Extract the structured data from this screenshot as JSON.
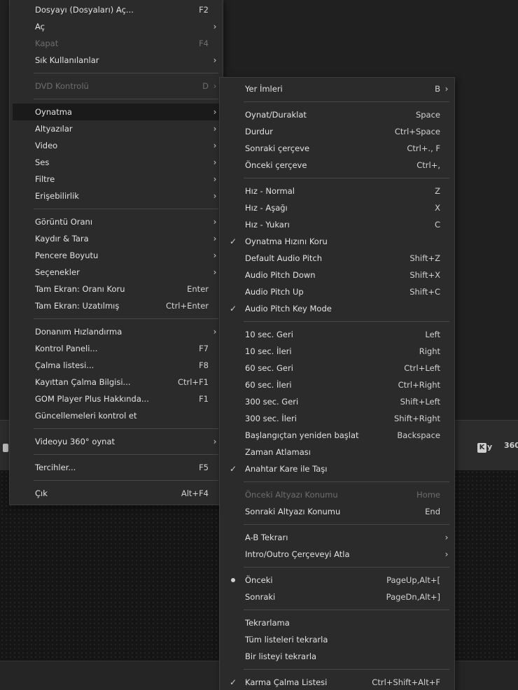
{
  "player_bar": {
    "ky_k": "K",
    "ky_y": "y",
    "vr_label": "360"
  },
  "main_menu": {
    "items": [
      {
        "label": "Dosyayı (Dosyaları) Aç...",
        "shortcut": "F2"
      },
      {
        "label": "Aç",
        "shortcut": ""
      },
      {
        "label": "Kapat",
        "shortcut": "F4"
      },
      {
        "label": "Sık Kullanılanlar",
        "shortcut": ""
      },
      {
        "label": "DVD Kontrolü",
        "shortcut": "D"
      },
      {
        "label": "Oynatma",
        "shortcut": ""
      },
      {
        "label": "Altyazılar",
        "shortcut": ""
      },
      {
        "label": "Video",
        "shortcut": ""
      },
      {
        "label": "Ses",
        "shortcut": ""
      },
      {
        "label": "Filtre",
        "shortcut": ""
      },
      {
        "label": "Erişebilirlik",
        "shortcut": ""
      },
      {
        "label": "Görüntü Oranı",
        "shortcut": ""
      },
      {
        "label": "Kaydır & Tara",
        "shortcut": ""
      },
      {
        "label": "Pencere Boyutu",
        "shortcut": ""
      },
      {
        "label": "Seçenekler",
        "shortcut": ""
      },
      {
        "label": "Tam Ekran: Oranı Koru",
        "shortcut": "Enter"
      },
      {
        "label": "Tam Ekran: Uzatılmış",
        "shortcut": "Ctrl+Enter"
      },
      {
        "label": "Donanım Hızlandırma",
        "shortcut": ""
      },
      {
        "label": "Kontrol Paneli...",
        "shortcut": "F7"
      },
      {
        "label": "Çalma listesi...",
        "shortcut": "F8"
      },
      {
        "label": "Kayıttan Çalma Bilgisi...",
        "shortcut": "Ctrl+F1"
      },
      {
        "label": "GOM Player Plus Hakkında...",
        "shortcut": "F1"
      },
      {
        "label": "Güncellemeleri kontrol et",
        "shortcut": ""
      },
      {
        "label": "Videoyu 360° oynat",
        "shortcut": ""
      },
      {
        "label": "Tercihler...",
        "shortcut": "F5"
      },
      {
        "label": "Çık",
        "shortcut": "Alt+F4"
      }
    ]
  },
  "playback_menu": {
    "items": [
      {
        "label": "Yer İmleri",
        "shortcut": "B"
      },
      {
        "label": "Oynat/Duraklat",
        "shortcut": "Space"
      },
      {
        "label": "Durdur",
        "shortcut": "Ctrl+Space"
      },
      {
        "label": "Sonraki çerçeve",
        "shortcut": "Ctrl+., F"
      },
      {
        "label": "Önceki çerçeve",
        "shortcut": "Ctrl+,"
      },
      {
        "label": "Hız - Normal",
        "shortcut": "Z"
      },
      {
        "label": "Hız - Aşağı",
        "shortcut": "X"
      },
      {
        "label": "Hız - Yukarı",
        "shortcut": "C"
      },
      {
        "label": "Oynatma Hızını Koru",
        "shortcut": ""
      },
      {
        "label": "Default Audio Pitch",
        "shortcut": "Shift+Z"
      },
      {
        "label": "Audio Pitch Down",
        "shortcut": "Shift+X"
      },
      {
        "label": "Audio Pitch Up",
        "shortcut": "Shift+C"
      },
      {
        "label": "Audio Pitch Key Mode",
        "shortcut": ""
      },
      {
        "label": "10 sec. Geri",
        "shortcut": "Left"
      },
      {
        "label": "10 sec. İleri",
        "shortcut": "Right"
      },
      {
        "label": "60 sec. Geri",
        "shortcut": "Ctrl+Left"
      },
      {
        "label": "60 sec. İleri",
        "shortcut": "Ctrl+Right"
      },
      {
        "label": "300 sec. Geri",
        "shortcut": "Shift+Left"
      },
      {
        "label": "300 sec. İleri",
        "shortcut": "Shift+Right"
      },
      {
        "label": "Başlangıçtan yeniden başlat",
        "shortcut": "Backspace"
      },
      {
        "label": "Zaman Atlaması",
        "shortcut": ""
      },
      {
        "label": "Anahtar Kare ile Taşı",
        "shortcut": ""
      },
      {
        "label": "Önceki Altyazı Konumu",
        "shortcut": "Home"
      },
      {
        "label": "Sonraki Altyazı Konumu",
        "shortcut": "End"
      },
      {
        "label": "A-B Tekrarı",
        "shortcut": ""
      },
      {
        "label": "Intro/Outro Çerçeveyi Atla",
        "shortcut": ""
      },
      {
        "label": "Önceki",
        "shortcut": "PageUp,Alt+["
      },
      {
        "label": "Sonraki",
        "shortcut": "PageDn,Alt+]"
      },
      {
        "label": "Tekrarlama",
        "shortcut": ""
      },
      {
        "label": "Tüm listeleri tekrarla",
        "shortcut": ""
      },
      {
        "label": "Bir listeyi tekrarla",
        "shortcut": ""
      },
      {
        "label": "Karma Çalma Listesi",
        "shortcut": "Ctrl+Shift+Alt+F"
      }
    ]
  }
}
